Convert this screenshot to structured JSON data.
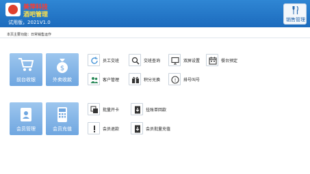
{
  "header": {
    "brand_top": "美萍科技",
    "brand_name": "酒吧管理",
    "version": "试用版，2021V1.0",
    "sales_label": "销售管理"
  },
  "breadcrumb": "本页主要功能：日常销售运作",
  "big_tiles": [
    {
      "label": "前台收银",
      "icon": "cart-icon"
    },
    {
      "label": "外卖收款",
      "icon": "money-bag-icon"
    },
    {
      "label": "会员管理",
      "icon": "member-card-icon"
    },
    {
      "label": "会员充值",
      "icon": "pos-terminal-icon"
    }
  ],
  "small_items": [
    {
      "label": "员工交班",
      "icon": "refresh-icon"
    },
    {
      "label": "交班查询",
      "icon": "search-icon"
    },
    {
      "label": "双屏设置",
      "icon": "monitor-icon"
    },
    {
      "label": "餐台预定",
      "icon": "calendar-icon"
    },
    {
      "label": "客户管理",
      "icon": "users-icon"
    },
    {
      "label": "积分兑换",
      "icon": "gift-icon"
    },
    {
      "label": "排号叫号",
      "icon": "queue-icon"
    },
    {
      "label": "批量开卡",
      "icon": "cards-icon"
    },
    {
      "label": "挂账单回款",
      "icon": "download-icon"
    },
    {
      "label": "会员退款",
      "icon": "alert-icon"
    },
    {
      "label": "会员批量充值",
      "icon": "batch-icon"
    }
  ],
  "colors": {
    "header": "#1f72c4",
    "tile": "#7fb2e5",
    "icon": "#3d8fd6"
  }
}
